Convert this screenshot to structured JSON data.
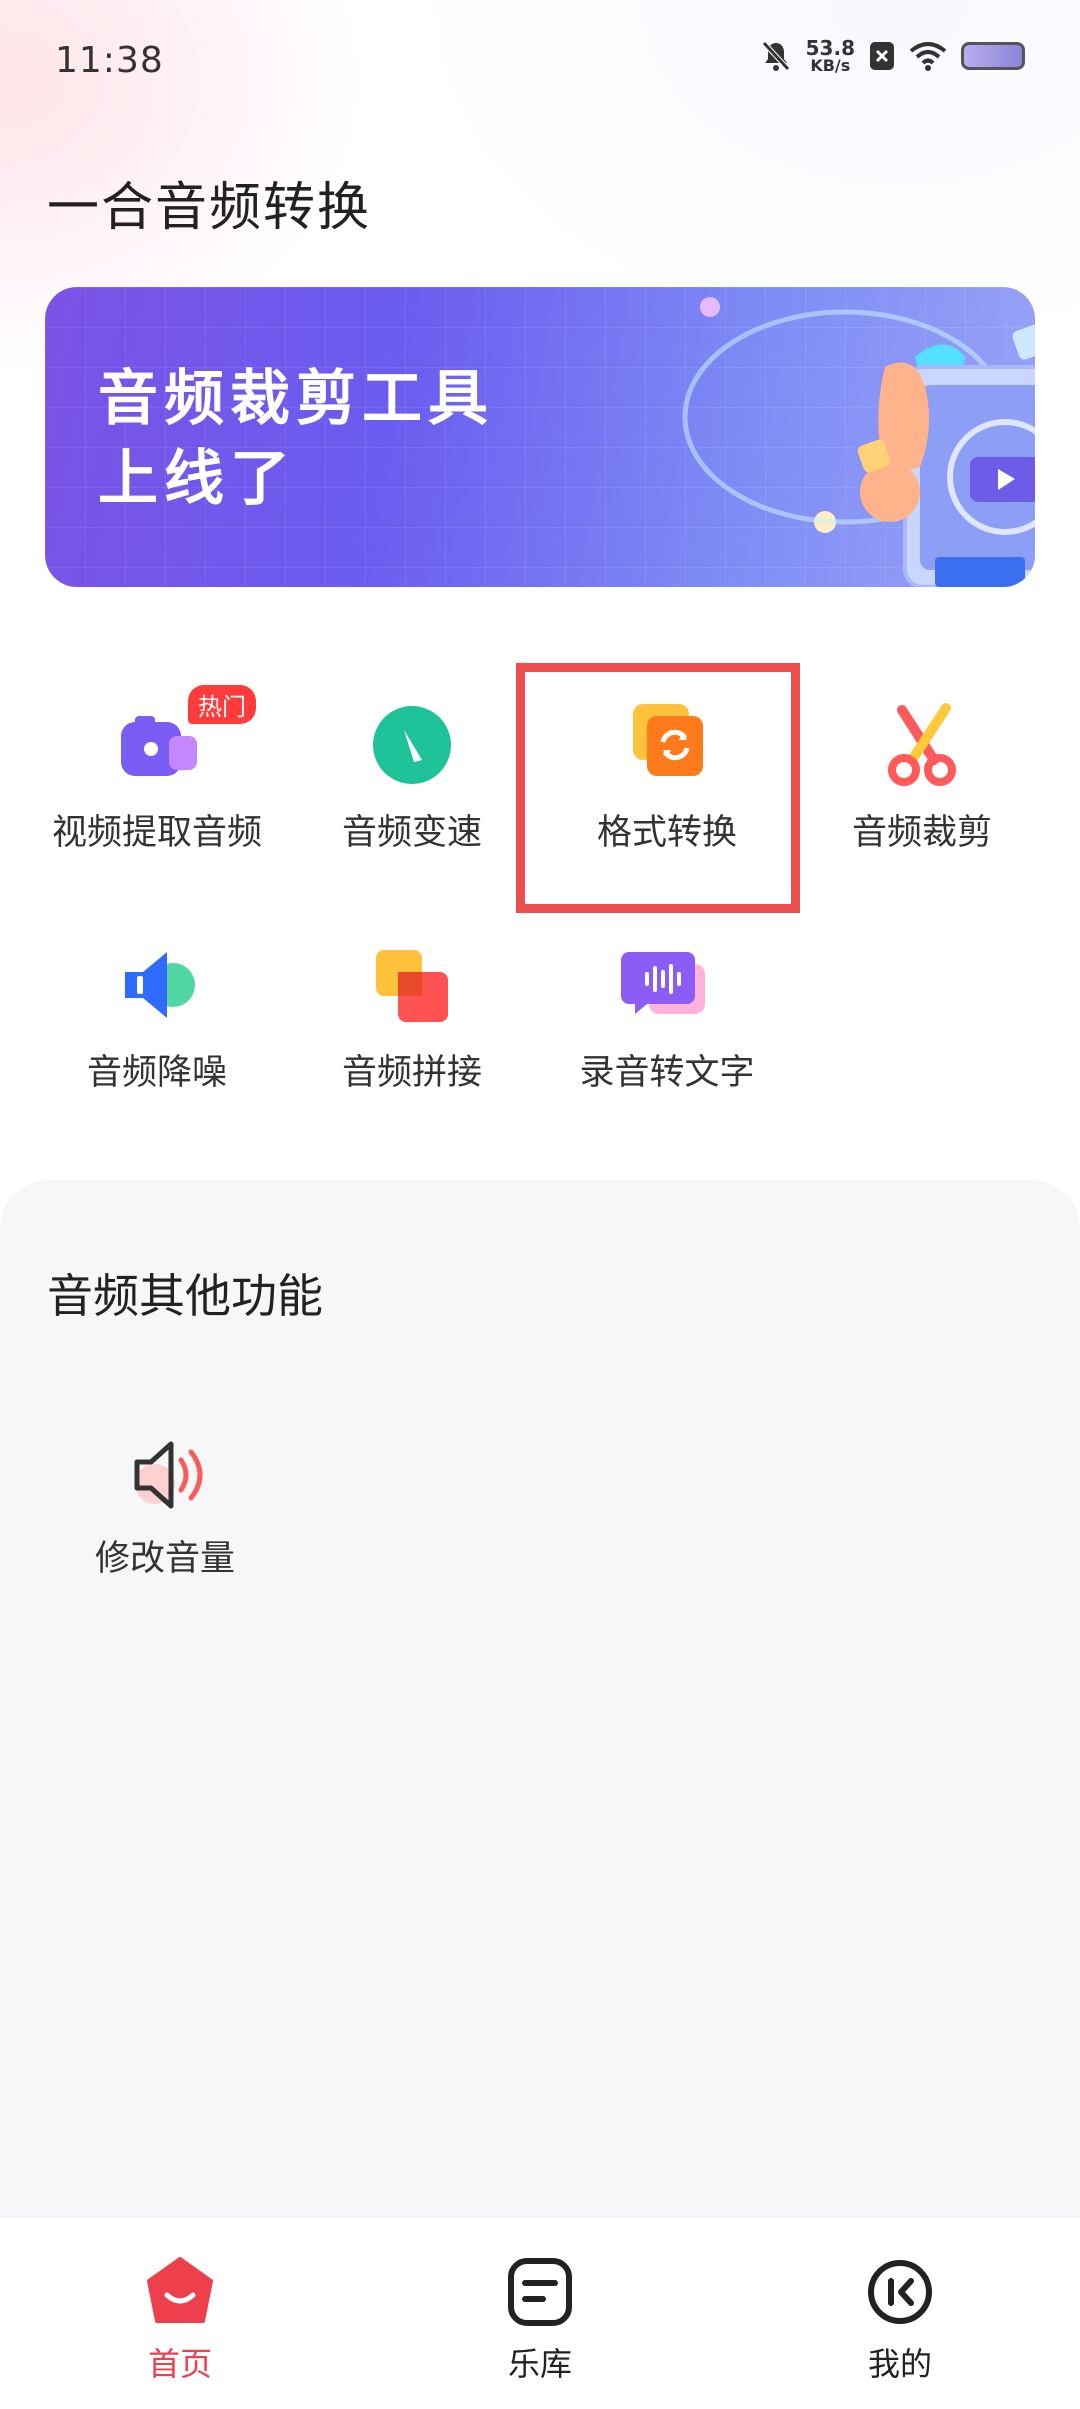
{
  "status_bar": {
    "time": "11:38",
    "net_speed_value": "53.8",
    "net_speed_unit": "KB/s"
  },
  "app": {
    "title": "一合音频转换"
  },
  "banner": {
    "line1": "音频裁剪工具",
    "line2": "上线了"
  },
  "tools": [
    {
      "label": "视频提取音频",
      "badge": "热门"
    },
    {
      "label": "音频变速"
    },
    {
      "label": "格式转换"
    },
    {
      "label": "音频裁剪"
    },
    {
      "label": "音频降噪"
    },
    {
      "label": "音频拼接"
    },
    {
      "label": "录音转文字"
    }
  ],
  "other_section": {
    "title": "音频其他功能",
    "items": [
      {
        "label": "修改音量"
      }
    ]
  },
  "bottom_nav": [
    {
      "label": "首页",
      "active": true
    },
    {
      "label": "乐库",
      "active": false
    },
    {
      "label": "我的",
      "active": false
    }
  ],
  "colors": {
    "accent": "#ee3f4d",
    "highlight_box": "#ee4d4d",
    "banner_start": "#7b52e6",
    "banner_end": "#9aa3f7"
  }
}
